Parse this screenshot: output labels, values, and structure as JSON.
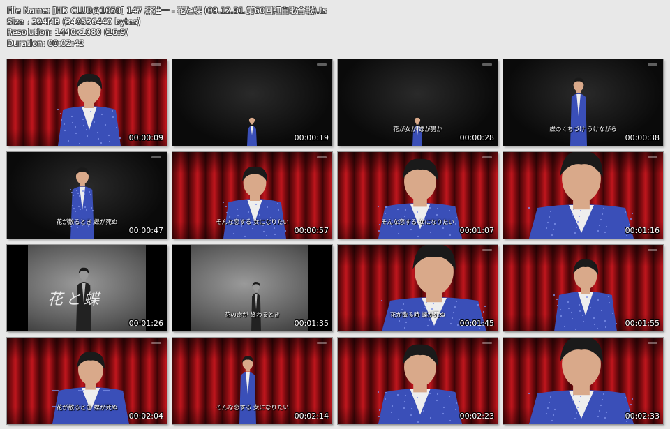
{
  "header": {
    "file_name": "File Name: [HD CLUB@1058] 147 森進一 - 花と蝶 (09.12.31.第60回紅白歌合戦).ts",
    "size": "Size : 324MB (340536440 bytes)",
    "resolution": "Resolution: 1440x1080 (16:9)",
    "duration": "Duration: 00:02:43"
  },
  "thumbnails": [
    {
      "time": "00:00:09",
      "scene": "stage",
      "shot": "medium",
      "subtitle": ""
    },
    {
      "time": "00:00:19",
      "scene": "dark",
      "shot": "wide",
      "subtitle": ""
    },
    {
      "time": "00:00:28",
      "scene": "dark",
      "shot": "wide",
      "subtitle": "花が女か 蝶が男か"
    },
    {
      "time": "00:00:38",
      "scene": "dark",
      "shot": "full",
      "subtitle": "蝶のくちづけ うけながら"
    },
    {
      "time": "00:00:47",
      "scene": "dark",
      "shot": "full-left",
      "subtitle": "花が散るとき 蝶が死ぬ"
    },
    {
      "time": "00:00:57",
      "scene": "stage",
      "shot": "medium",
      "subtitle": "そんな恋する 女になりたい"
    },
    {
      "time": "00:01:07",
      "scene": "stage",
      "shot": "close",
      "subtitle": "そんな恋する 女になりたい"
    },
    {
      "time": "00:01:16",
      "scene": "stage",
      "shot": "closeup",
      "subtitle": ""
    },
    {
      "time": "00:01:26",
      "scene": "bw",
      "shot": "archive",
      "subtitle": "",
      "title_card": "花と蝶"
    },
    {
      "time": "00:01:35",
      "scene": "bw",
      "shot": "archive2",
      "subtitle": "花の命が 終わるとき"
    },
    {
      "time": "00:01:45",
      "scene": "stage",
      "shot": "closeup-left",
      "subtitle": "花が散る時 蝶が死ぬ"
    },
    {
      "time": "00:01:55",
      "scene": "stage",
      "shot": "medium",
      "subtitle": ""
    },
    {
      "time": "00:02:04",
      "scene": "stage",
      "shot": "medium-left",
      "subtitle": "花が散るとき 蝶が死ぬ"
    },
    {
      "time": "00:02:14",
      "scene": "stage",
      "shot": "full",
      "subtitle": "そんな恋する 女になりたい"
    },
    {
      "time": "00:02:23",
      "scene": "stage",
      "shot": "close",
      "subtitle": ""
    },
    {
      "time": "00:02:33",
      "scene": "stage",
      "shot": "closeup",
      "subtitle": ""
    }
  ]
}
